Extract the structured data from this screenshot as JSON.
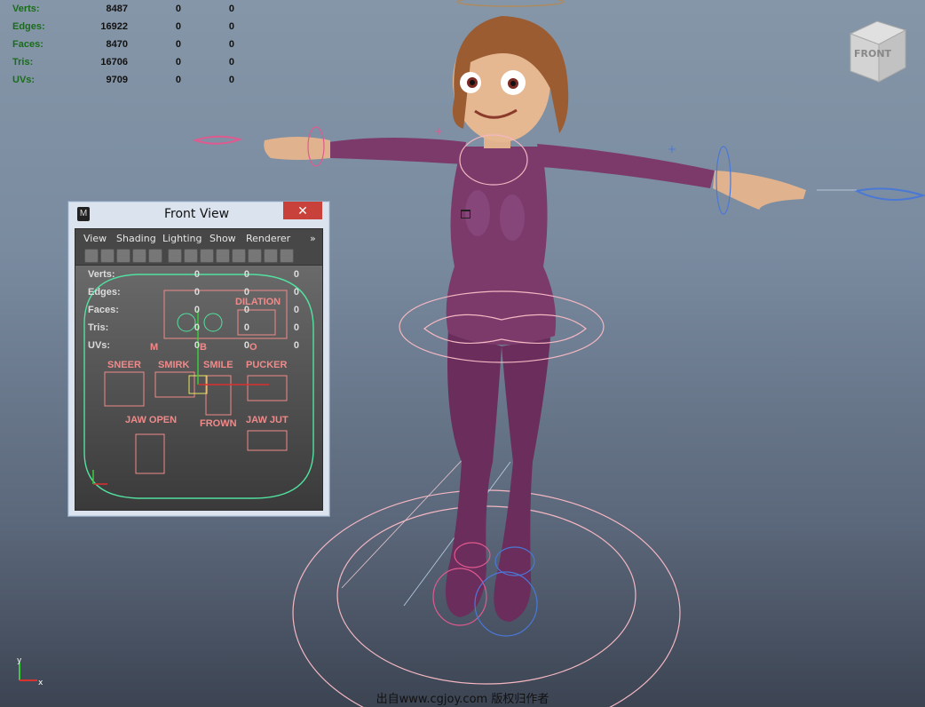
{
  "hud": {
    "rows": [
      {
        "label": "Verts:",
        "v1": "8487",
        "v2": "0",
        "v3": "0"
      },
      {
        "label": "Edges:",
        "v1": "16922",
        "v2": "0",
        "v3": "0"
      },
      {
        "label": "Faces:",
        "v1": "8470",
        "v2": "0",
        "v3": "0"
      },
      {
        "label": "Tris:",
        "v1": "16706",
        "v2": "0",
        "v3": "0"
      },
      {
        "label": "UVs:",
        "v1": "9709",
        "v2": "0",
        "v3": "0"
      }
    ]
  },
  "viewcube": {
    "label": "FRONT"
  },
  "window": {
    "title": "Front View",
    "minimize": "_",
    "close": "✕",
    "menu": [
      "View",
      "Shading",
      "Lighting",
      "Show",
      "Renderer"
    ],
    "menu_more": "»"
  },
  "subview": {
    "hud_rows": [
      {
        "label": "Verts:",
        "v1": "0",
        "v2": "0",
        "v3": "0"
      },
      {
        "label": "Edges:",
        "v1": "0",
        "v2": "0",
        "v3": "0"
      },
      {
        "label": "Faces:",
        "v1": "0",
        "v2": "0",
        "v3": "0"
      },
      {
        "label": "Tris:",
        "v1": "0",
        "v2": "0",
        "v3": "0"
      },
      {
        "label": "UVs:",
        "v1": "0",
        "v2": "0",
        "v3": "0"
      }
    ],
    "labels": {
      "dilation": "DILATION",
      "m": "M",
      "b": "B",
      "o": "O",
      "sneer": "SNEER",
      "smirk": "SMIRK",
      "smile": "SMILE",
      "pucker": "PUCKER",
      "jaw_open": "JAW OPEN",
      "frown": "FROWN",
      "jaw_jut": "JAW JUT"
    }
  },
  "watermark": "出自www.cgjoy.com 版权归作者"
}
